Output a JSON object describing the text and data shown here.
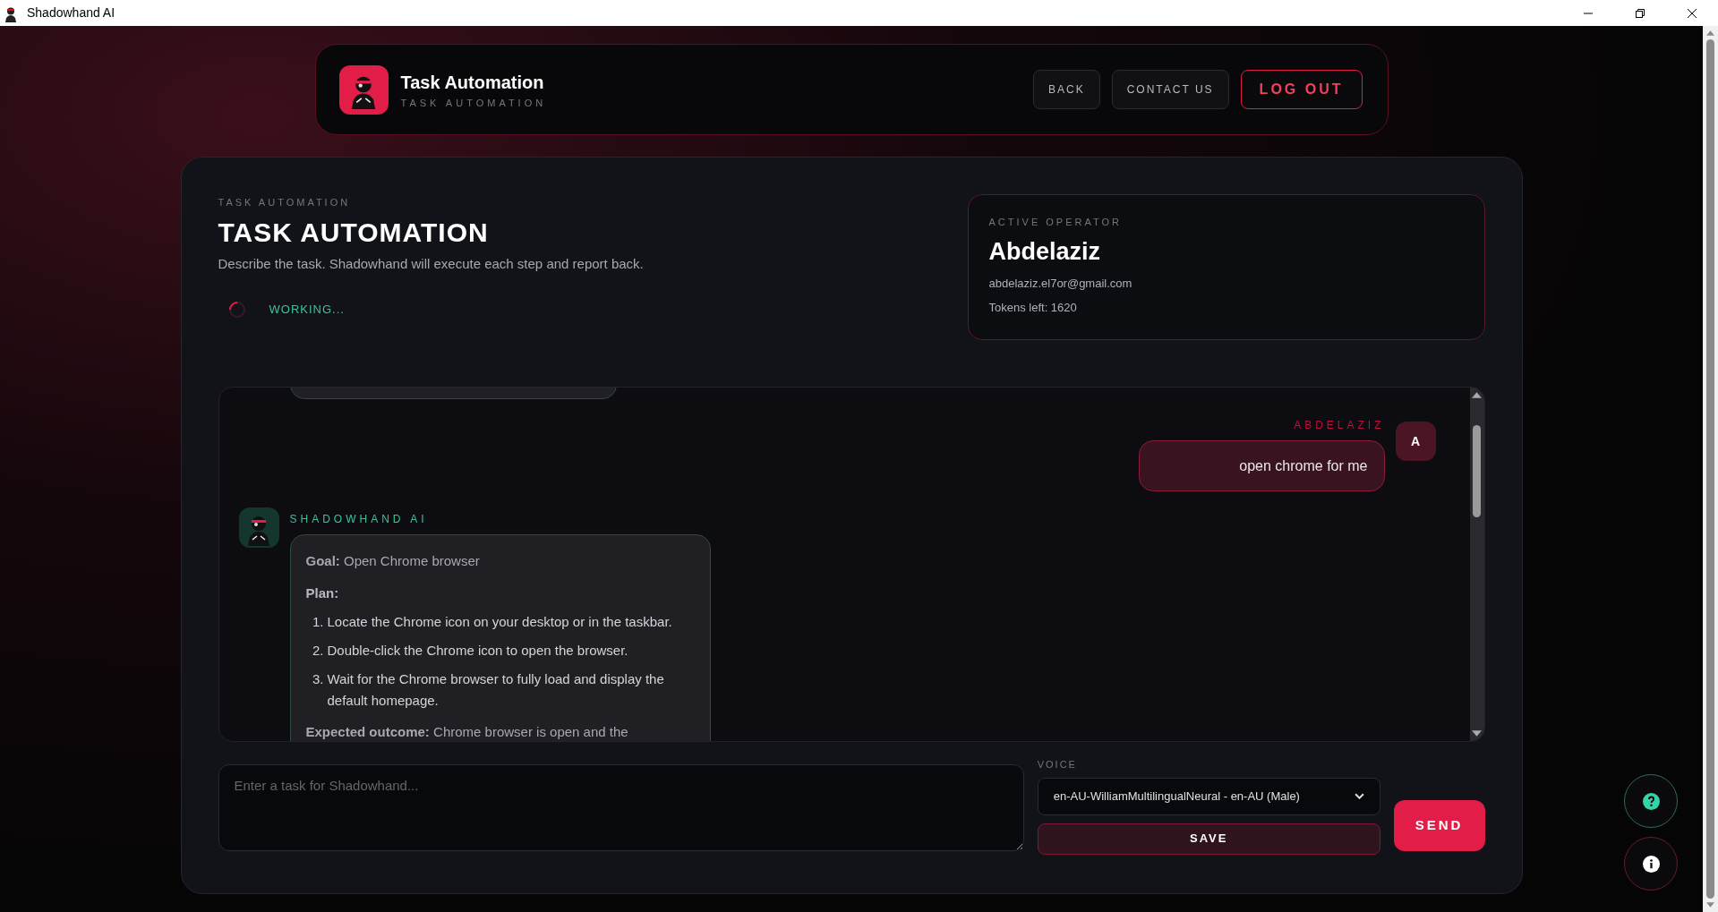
{
  "window": {
    "title": "Shadowhand AI"
  },
  "header": {
    "title": "Task Automation",
    "subtitle": "TASK AUTOMATION",
    "buttons": [
      {
        "label": "BACK",
        "kind": "plain"
      },
      {
        "label": "CONTACT US",
        "kind": "plain"
      },
      {
        "label": "LOG OUT",
        "kind": "danger"
      }
    ]
  },
  "intro": {
    "eyebrow": "TASK AUTOMATION",
    "title": "TASK AUTOMATION",
    "description": "Describe the task. Shadowhand will execute each step and report back.",
    "status": "WORKING..."
  },
  "operator": {
    "label": "ACTIVE OPERATOR",
    "name": "Abdelaziz",
    "email": "abdelaziz.el7or@gmail.com",
    "tokens": "Tokens left: 1620"
  },
  "messages": [
    {
      "kind": "user",
      "sender": "ABDELAZIZ",
      "avatar": "A",
      "text": "open chrome for me"
    },
    {
      "kind": "assistant",
      "sender": "SHADOWHAND AI",
      "goal": "**Goal:** Open Chrome browser",
      "plan": "Plan:",
      "steps": [
        {
          "number": "1.",
          "text": "Locate the Chrome icon on your desktop or in the taskbar."
        },
        {
          "number": "2.",
          "text": "Double-click the Chrome icon to open the browser."
        },
        {
          "number": "3.",
          "text": "Wait for the Chrome browser to fully load and display the default homepage."
        }
      ],
      "outcome": "**Expected outcome:** Chrome browser is open and the"
    }
  ],
  "composer": {
    "placeholder": "Enter a task for Shadowhand...",
    "voice_label": "VOICE",
    "voice": "en-AU-WilliamMultilingualNeural - en-AU (Male)",
    "save": "SAVE",
    "send": "SEND"
  }
}
